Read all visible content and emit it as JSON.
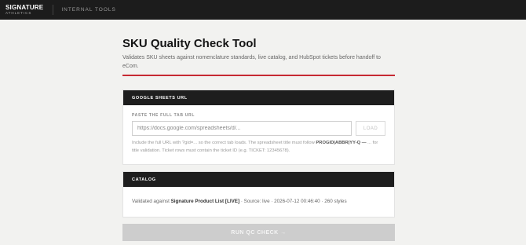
{
  "brand": {
    "name": "SIGNATURE",
    "sub": "ATHLETICS"
  },
  "topbar": {
    "section": "INTERNAL TOOLS"
  },
  "page": {
    "title": "SKU Quality Check Tool",
    "subtitle": "Validates SKU sheets against nomenclature standards, live catalog, and HubSpot tickets before handoff to eCom."
  },
  "sheets": {
    "header": "GOOGLE SHEETS URL",
    "field_label": "PASTE THE FULL TAB URL",
    "input_value": "",
    "input_placeholder": "https://docs.google.com/spreadsheets/d/...",
    "load_label": "LOAD",
    "help_before": "Include the full URL with ?gid=... so the correct tab loads. The spreadsheet title must follow ",
    "help_bold": "PROGID|ABBR|YY-Q —",
    "help_after": " ... for title validation. Ticket rows must contain the ticket ID (e.g. TICKET: 12345678)."
  },
  "catalog": {
    "header": "CATALOG",
    "prefix": "Validated against ",
    "list_name": "Signature Product List [LIVE]",
    "suffix": " · Source: live · 2026-07-12 00:46:40 · 260 styles"
  },
  "run": {
    "label": "RUN QC CHECK →"
  },
  "colors": {
    "accent": "#c62a33",
    "header_bg": "#1e1e1e",
    "topbar_bg": "#1c1c1c"
  }
}
